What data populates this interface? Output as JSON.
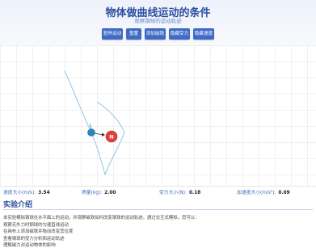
{
  "header": {
    "title": "物体做曲线运动的条件",
    "subtitle": "观察钢球的运动轨迹"
  },
  "controls": {
    "pause_label": "暂停运动",
    "reset_label": "重置",
    "add_magnet_label": "添加磁铁",
    "hide_force_label": "隐藏受力",
    "hide_velocity_label": "隐藏速度"
  },
  "simulation": {
    "magnet_label": "N",
    "colors": {
      "ball": "#2c87b7",
      "magnet": "#e0403a",
      "trajectory": "#8bbfe0"
    }
  },
  "stats": {
    "velocity_label": "速度大小(m/s):",
    "velocity_value": "3.54",
    "mass_label": "质量(kg):",
    "mass_value": "2.00",
    "force_label": "受力大小(N):",
    "force_value": "0.18",
    "accel_label": "加速度大小(m/s²):",
    "accel_value": "0.09"
  },
  "intro": {
    "title": "实验介绍",
    "lines": [
      "本实验模拟钢球在水平面上的运动，并观察磁铁如何改变钢球的运动轨迹。通过交互式模拟，您可以：",
      "观察无外力时钢球的匀速直线运动",
      "在画布上添加磁铁并拖动改变其位置",
      "查看钢球的受力分析和运动轨迹",
      "理解磁力对运动物体的影响"
    ]
  }
}
